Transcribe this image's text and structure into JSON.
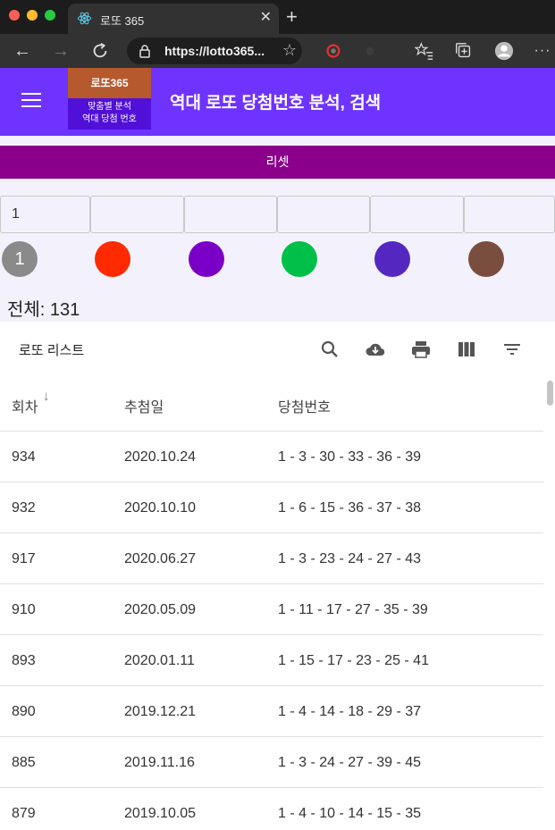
{
  "browser": {
    "tab_title": "로또 365",
    "url": "https://lotto365..."
  },
  "appbar": {
    "logo_top": "로또365",
    "logo_line1": "맞춤별 분석",
    "logo_line2": "역대 당첨 번호",
    "title": "역대 로또 당첨번호 분석, 검색"
  },
  "reset_label": "리셋",
  "inputs": [
    "1",
    "",
    "",
    "",
    "",
    ""
  ],
  "balls": [
    {
      "label": "1",
      "color": "#8a8a8a"
    },
    {
      "label": "",
      "color": "#ff2a00"
    },
    {
      "label": "",
      "color": "#7a00c8"
    },
    {
      "label": "",
      "color": "#00c04a"
    },
    {
      "label": "",
      "color": "#5428c0"
    },
    {
      "label": "",
      "color": "#7a4e3e"
    }
  ],
  "total_label": "전체: 131",
  "table": {
    "title": "로또 리스트",
    "toolbar_icons": [
      "search-icon",
      "download-icon",
      "print-icon",
      "columns-icon",
      "filter-icon"
    ],
    "headers": [
      "회차",
      "추첨일",
      "당첨번호"
    ],
    "rows": [
      {
        "round": "934",
        "date": "2020.10.24",
        "numbers": "1 - 3 - 30 - 33 - 36 - 39"
      },
      {
        "round": "932",
        "date": "2020.10.10",
        "numbers": "1 - 6 - 15 - 36 - 37 - 38"
      },
      {
        "round": "917",
        "date": "2020.06.27",
        "numbers": "1 - 3 - 23 - 24 - 27 - 43"
      },
      {
        "round": "910",
        "date": "2020.05.09",
        "numbers": "1 - 11 - 17 - 27 - 35 - 39"
      },
      {
        "round": "893",
        "date": "2020.01.11",
        "numbers": "1 - 15 - 17 - 23 - 25 - 41"
      },
      {
        "round": "890",
        "date": "2019.12.21",
        "numbers": "1 - 4 - 14 - 18 - 29 - 37"
      },
      {
        "round": "885",
        "date": "2019.11.16",
        "numbers": "1 - 3 - 24 - 27 - 39 - 45"
      },
      {
        "round": "879",
        "date": "2019.10.05",
        "numbers": "1 - 4 - 10 - 14 - 15 - 35"
      }
    ]
  }
}
